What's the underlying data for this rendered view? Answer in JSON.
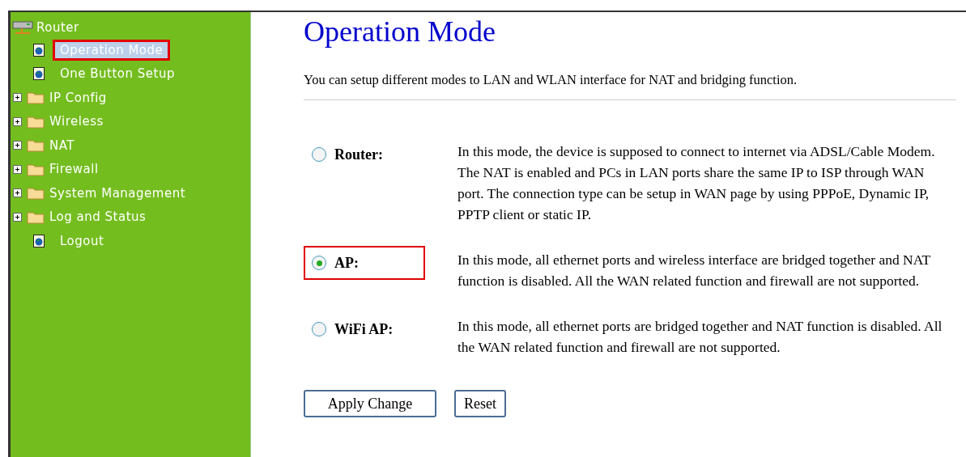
{
  "sidebar": {
    "root": "Router",
    "items": [
      {
        "kind": "page",
        "label": "Operation Mode",
        "selected": true,
        "highlighted": true
      },
      {
        "kind": "page",
        "label": "One Button Setup",
        "selected": false,
        "highlighted": false
      },
      {
        "kind": "folder",
        "label": "IP Config",
        "expanded": false
      },
      {
        "kind": "folder",
        "label": "Wireless",
        "expanded": false
      },
      {
        "kind": "folder",
        "label": "NAT",
        "expanded": false
      },
      {
        "kind": "folder",
        "label": "Firewall",
        "expanded": false
      },
      {
        "kind": "folder",
        "label": "System Management",
        "expanded": false
      },
      {
        "kind": "folder",
        "label": "Log and Status",
        "expanded": false
      },
      {
        "kind": "page",
        "label": "Logout",
        "selected": false,
        "highlighted": false
      }
    ]
  },
  "main": {
    "title": "Operation Mode",
    "description": "You can setup different modes to LAN and WLAN interface for NAT and bridging function.",
    "modes": [
      {
        "label": "Router:",
        "selected": false,
        "highlighted": false,
        "description": "In this mode, the device is supposed to connect to internet via ADSL/Cable Modem. The NAT is enabled and PCs in LAN ports share the same IP to ISP through WAN port. The connection type can be setup in WAN page by using PPPoE, Dynamic IP, PPTP client or static IP."
      },
      {
        "label": "AP:",
        "selected": true,
        "highlighted": true,
        "description": "In this mode, all ethernet ports and wireless interface are bridged together and NAT function is disabled. All the WAN related function and firewall are not supported."
      },
      {
        "label": "WiFi AP:",
        "selected": false,
        "highlighted": false,
        "description": "In this mode, all ethernet ports are bridged together and NAT function is disabled. All the WAN related function and firewall are not supported."
      }
    ],
    "buttons": [
      "Apply Change",
      "Reset"
    ]
  }
}
